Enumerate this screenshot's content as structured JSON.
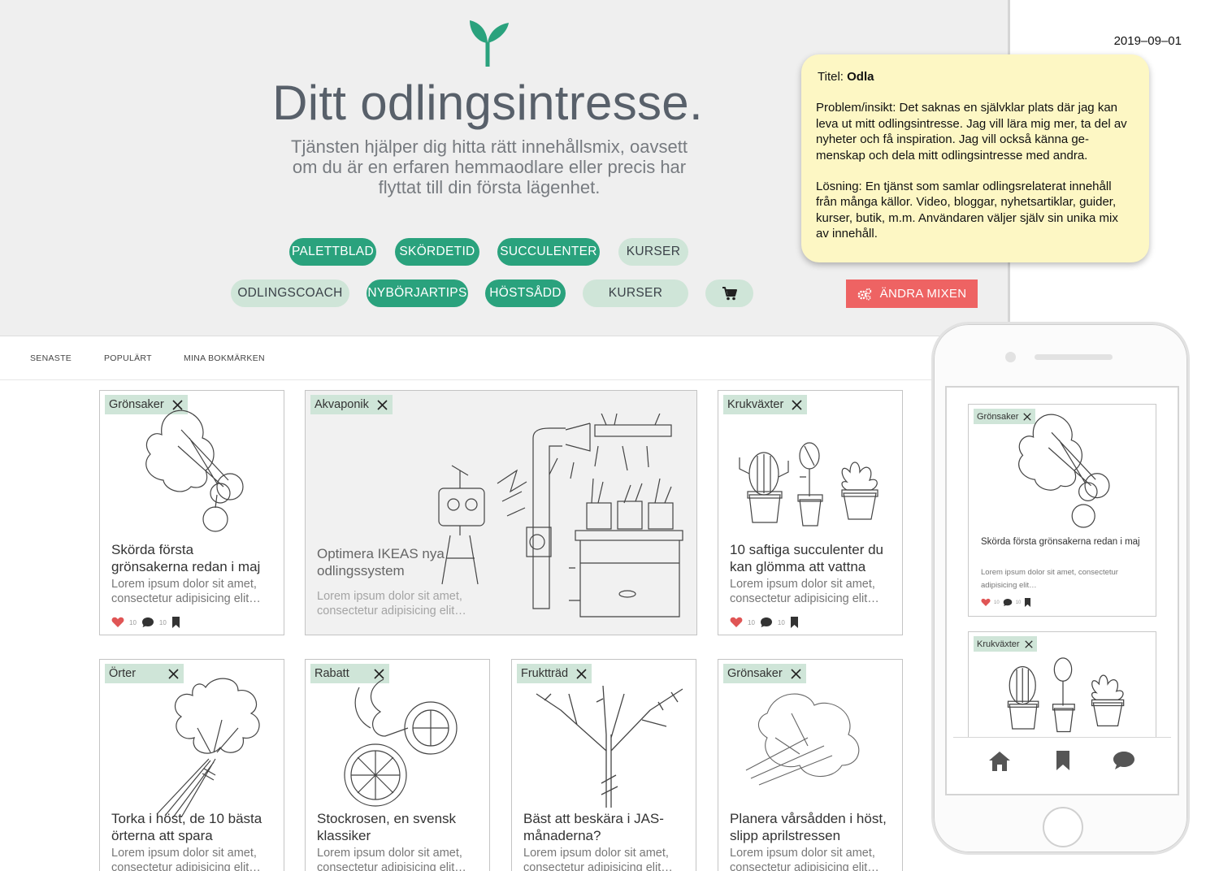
{
  "hero": {
    "title": "Ditt odlingsintresse.",
    "subtitle_lines": [
      "Tjänsten hjälper dig hitta rätt innehållsmix, oavsett",
      "om du är en erfaren hemmaodlare eller precis har",
      "flyttat till din första lägenhet."
    ],
    "logo_icon": "sprout-icon",
    "accent_color": "#2aa27d"
  },
  "chips": [
    {
      "label": "PALETTBLAD",
      "active": true
    },
    {
      "label": "SKÖRDETID",
      "active": true
    },
    {
      "label": "SUCCULENTER",
      "active": true
    },
    {
      "label": "KURSER",
      "active": false
    },
    {
      "label": "ODLINGSCOACH",
      "active": false
    },
    {
      "label": "NYBÖRJARTIPS",
      "active": true
    },
    {
      "label": "HÖSTSÅDD",
      "active": true
    },
    {
      "label": "KURSER",
      "active": false
    },
    {
      "label": "",
      "icon": "cart-icon",
      "active": false
    }
  ],
  "mix_button": {
    "label": "ÄNDRA MIXEN",
    "icon": "gears-icon",
    "color": "#ee6363"
  },
  "date": "2019–09–01",
  "note": {
    "title_label": "Titel:",
    "title_value": "Odla",
    "problem": "Problem/insikt: Det saknas en självklar plats där jag kan leva ut mitt odlingsintresse. Jag vill lära mig mer, ta del av nyheter och få inspiration. Jag vill också känna ge-menskap och dela mitt odlingsintresse med andra.",
    "solution": "Lösning: En tjänst som samlar odlingsrelaterat innehåll från många källor. Video, bloggar, nyhetsartiklar, guider, kurser, butik, m.m. Användaren väljer själv sin unika mix av innehåll."
  },
  "subnav": [
    "SENASTE",
    "POPULÄRT",
    "MINA BOKMÄRKEN"
  ],
  "cards": [
    {
      "tag": "Grönsaker",
      "title": "Skörda första grönsakerna redan i maj",
      "body": "Lorem ipsum dolor sit amet, consectetur adipisicing elit…",
      "likes": "10",
      "comments": "10"
    },
    {
      "tag": "Akvaponik",
      "title": "Optimera IKEAS nya odlingssystem",
      "body": "Lorem ipsum dolor sit amet, consectetur adipisicing elit…"
    },
    {
      "tag": "Krukväxter",
      "title": "10 saftiga succulenter du kan glömma att vattna",
      "body": "Lorem ipsum dolor sit amet, consectetur adipisicing elit…",
      "likes": "10",
      "comments": "10"
    },
    {
      "tag": "Örter",
      "title": "Torka i höst, de 10 bästa örterna att spara",
      "body": "Lorem ipsum dolor sit amet, consectetur adipisicing elit…"
    },
    {
      "tag": "Rabatt",
      "title": "Stockrosen, en svensk klassiker",
      "body": "Lorem ipsum dolor sit amet, consectetur adipisicing elit…"
    },
    {
      "tag": "Fruktträd",
      "title": "Bäst att beskära i JAS-månaderna?",
      "body": "Lorem ipsum dolor sit amet, consectetur adipisicing elit…"
    },
    {
      "tag": "Grönsaker",
      "title": "Planera vårsådden i höst, slipp aprilstressen",
      "body": "Lorem ipsum dolor sit amet, consectetur adipisicing elit…"
    }
  ],
  "phone": {
    "cards": [
      {
        "tag": "Grönsaker",
        "title": "Skörda första grönsakerna redan i maj",
        "body": "Lorem ipsum dolor sit amet, consectetur adipisicing elit…",
        "likes": "10",
        "comments": "10"
      },
      {
        "tag": "Krukväxter"
      }
    ],
    "tabbar": [
      "home-icon",
      "bookmark-icon",
      "chat-icon"
    ]
  }
}
